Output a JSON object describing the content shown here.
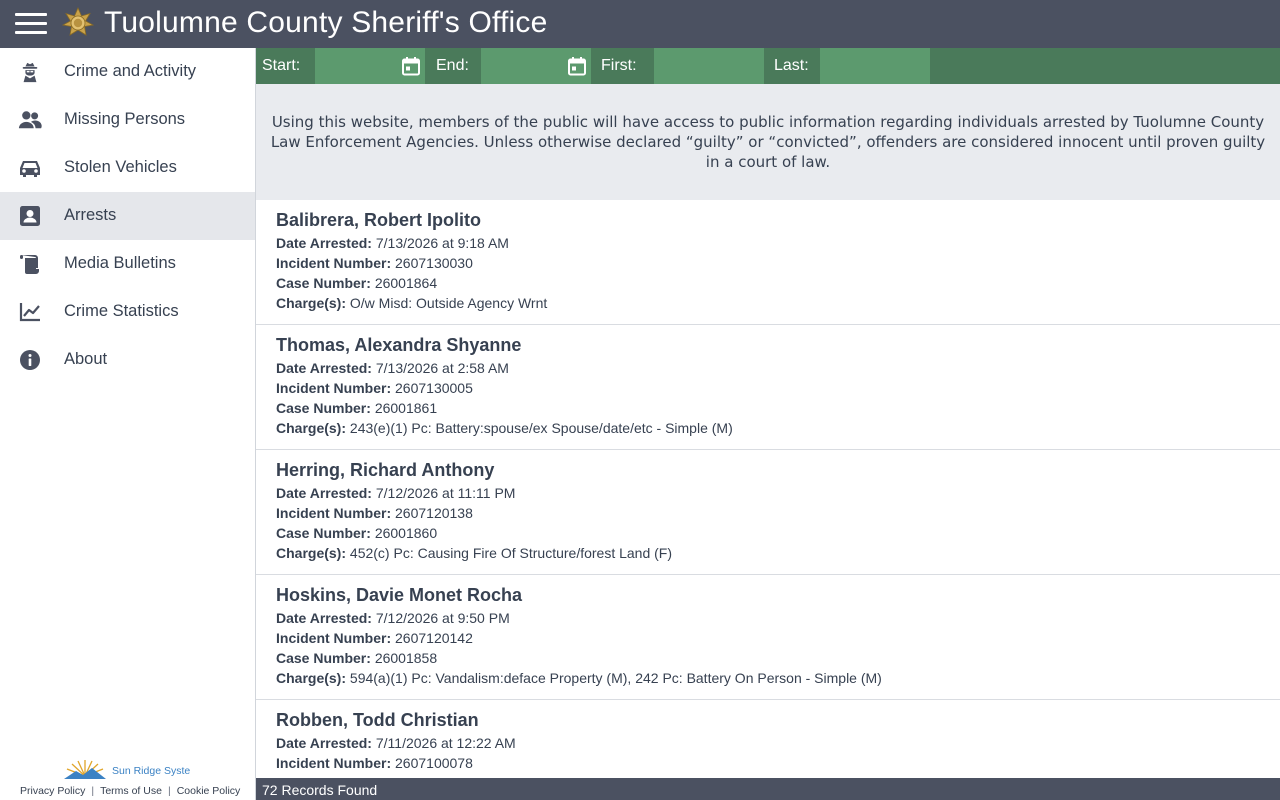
{
  "header": {
    "title": "Tuolumne County Sheriff's Office"
  },
  "sidebar": {
    "items": [
      {
        "label": "Crime and Activity",
        "icon": "detective-icon"
      },
      {
        "label": "Missing Persons",
        "icon": "people-icon"
      },
      {
        "label": "Stolen Vehicles",
        "icon": "car-icon"
      },
      {
        "label": "Arrests",
        "icon": "id-badge-icon",
        "active": true
      },
      {
        "label": "Media Bulletins",
        "icon": "scroll-icon"
      },
      {
        "label": "Crime Statistics",
        "icon": "chart-line-icon"
      },
      {
        "label": "About",
        "icon": "info-icon"
      }
    ],
    "footer": {
      "logo_text": "Sun Ridge Syste",
      "links": [
        "Privacy Policy",
        "Terms of Use",
        "Cookie Policy"
      ]
    }
  },
  "filters": {
    "start_label": "Start:",
    "end_label": "End:",
    "first_label": "First:",
    "last_label": "Last:",
    "start_value": "",
    "end_value": "",
    "first_value": "",
    "last_value": ""
  },
  "disclaimer": "Using this website, members of the public will have access to public information regarding individuals arrested by Tuolumne County Law Enforcement Agencies. Unless otherwise declared “guilty” or “convicted”, offenders are considered innocent until proven guilty in a court of law.",
  "field_labels": {
    "date": "Date Arrested:",
    "incident": "Incident Number:",
    "case": "Case Number:",
    "charges": "Charge(s):"
  },
  "records": [
    {
      "name": "Balibrera, Robert Ipolito",
      "date": "7/13/2026 at 9:18 AM",
      "incident": "2607130030",
      "case": "26001864",
      "charges": "O/w Misd: Outside Agency Wrnt"
    },
    {
      "name": "Thomas, Alexandra Shyanne",
      "date": "7/13/2026 at 2:58 AM",
      "incident": "2607130005",
      "case": "26001861",
      "charges": "243(e)(1) Pc: Battery:spouse/ex Spouse/date/etc - Simple (M)"
    },
    {
      "name": "Herring, Richard Anthony",
      "date": "7/12/2026 at 11:11 PM",
      "incident": "2607120138",
      "case": "26001860",
      "charges": "452(c) Pc: Causing Fire Of Structure/forest Land (F)"
    },
    {
      "name": "Hoskins, Davie Monet Rocha",
      "date": "7/12/2026 at 9:50 PM",
      "incident": "2607120142",
      "case": "26001858",
      "charges": "594(a)(1) Pc: Vandalism:deface Property (M), 242 Pc: Battery On Person - Simple (M)"
    },
    {
      "name": "Robben, Todd Christian",
      "date": "7/11/2026 at 12:22 AM",
      "incident": "2607100078",
      "case": "",
      "charges": ""
    }
  ],
  "status": {
    "records_found": "72 Records Found"
  }
}
